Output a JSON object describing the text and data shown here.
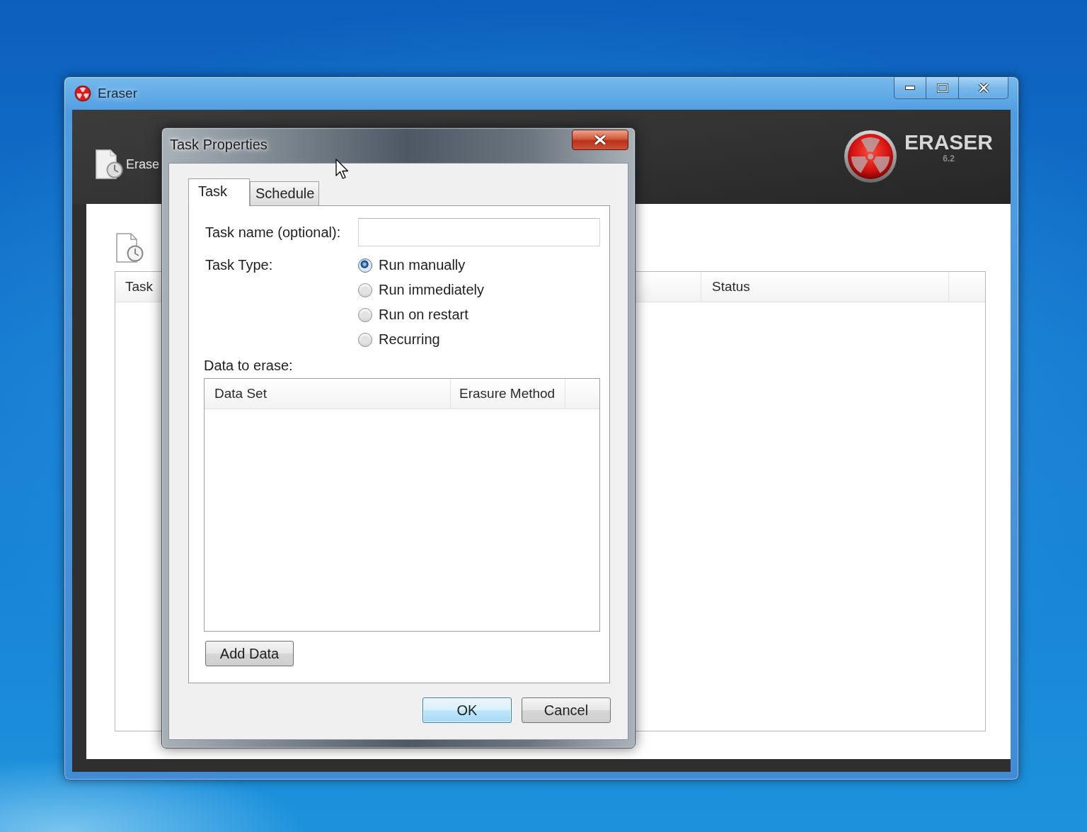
{
  "main_window": {
    "title": "Eraser",
    "toolbar": {
      "label": "Erase"
    },
    "logo": {
      "name": "ERASER",
      "version": "6.2"
    },
    "task_list": {
      "columns": [
        "Task",
        "Status"
      ]
    }
  },
  "dialog": {
    "title": "Task Properties",
    "tabs": [
      {
        "label": "Task",
        "selected": true
      },
      {
        "label": "Schedule",
        "selected": false
      }
    ],
    "task_name": {
      "label": "Task name (optional):"
    },
    "task_type": {
      "label": "Task Type:",
      "options": [
        {
          "label": "Run manually",
          "selected": true
        },
        {
          "label": "Run immediately",
          "selected": false
        },
        {
          "label": "Run on restart",
          "selected": false
        },
        {
          "label": "Recurring",
          "selected": false
        }
      ]
    },
    "data_to_erase": {
      "label": "Data to erase:",
      "columns": [
        "Data Set",
        "Erasure Method"
      ]
    },
    "add_button": {
      "label": "Add Data"
    },
    "buttons": [
      {
        "label": "OK",
        "default": true
      },
      {
        "label": "Cancel",
        "default": false
      }
    ]
  }
}
